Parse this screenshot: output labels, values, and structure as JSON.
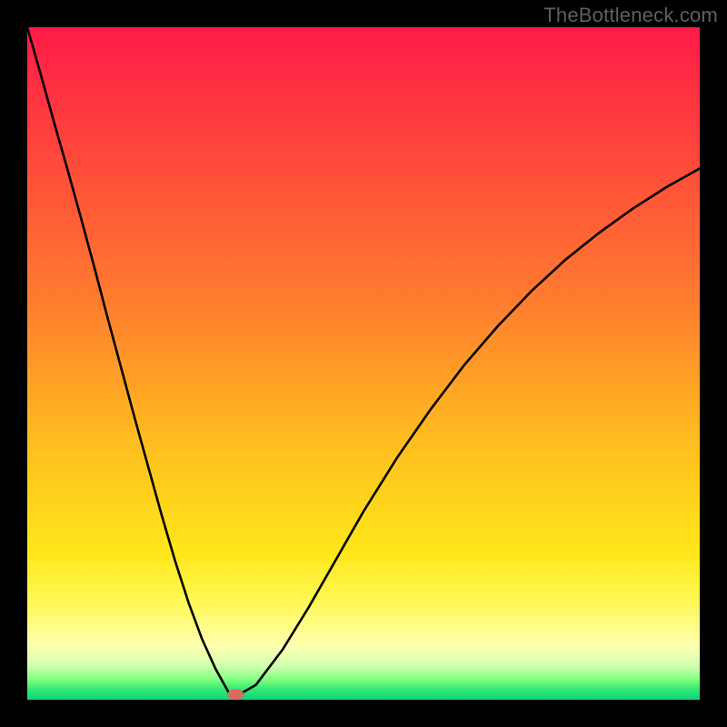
{
  "watermark": "TheBottleneck.com",
  "colors": {
    "frame": "#000000",
    "curve": "#000000",
    "watermark": "#5f5f5f",
    "gradient_top": "#ff1b48",
    "gradient_bottom": "#12d27a",
    "marker": "#d96b5f"
  },
  "chart_data": {
    "type": "line",
    "title": "",
    "xlabel": "",
    "ylabel": "",
    "xlim": [
      0,
      1
    ],
    "ylim": [
      0,
      1
    ],
    "grid": false,
    "legend": false,
    "series": [
      {
        "name": "curve",
        "x": [
          0.0,
          0.02,
          0.04,
          0.06,
          0.08,
          0.1,
          0.12,
          0.14,
          0.16,
          0.18,
          0.2,
          0.22,
          0.24,
          0.26,
          0.28,
          0.3,
          0.305,
          0.31,
          0.34,
          0.38,
          0.42,
          0.46,
          0.5,
          0.55,
          0.6,
          0.65,
          0.7,
          0.75,
          0.8,
          0.85,
          0.9,
          0.95,
          1.0
        ],
        "y": [
          1.0,
          0.93,
          0.858,
          0.788,
          0.716,
          0.642,
          0.566,
          0.492,
          0.418,
          0.346,
          0.274,
          0.206,
          0.144,
          0.09,
          0.046,
          0.01,
          0.005,
          0.005,
          0.022,
          0.075,
          0.14,
          0.21,
          0.28,
          0.36,
          0.432,
          0.498,
          0.556,
          0.608,
          0.654,
          0.694,
          0.73,
          0.762,
          0.79
        ]
      }
    ],
    "marker": {
      "x": 0.31,
      "y": 0.008,
      "rx": 0.012,
      "ry": 0.008
    }
  }
}
